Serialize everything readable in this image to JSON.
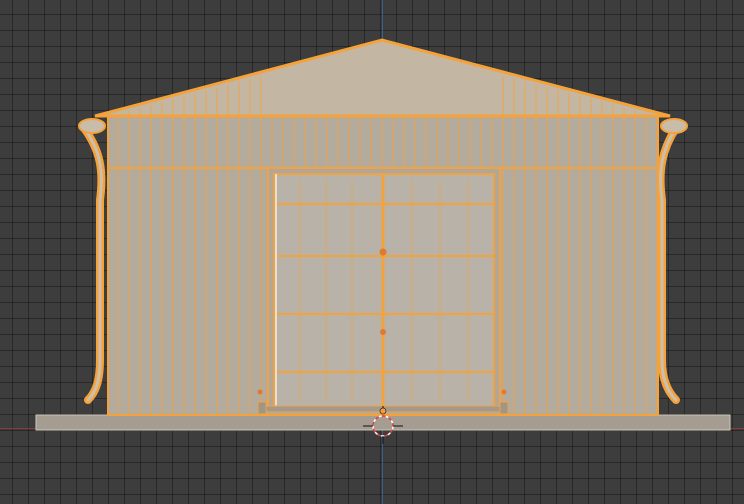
{
  "colors": {
    "background": "#3d3d3d",
    "selection_outline": "#f5a23a",
    "mesh_fill": "#b4ab9f",
    "roof_fill": "#c3b6a3",
    "foundation_fill": "#a69d92",
    "axis_x": "#8a3b3b",
    "axis_z": "#3b5f8f"
  },
  "viewport": {
    "object": "shed-mesh",
    "view": "front-orthographic",
    "selected": true
  },
  "icons": [
    "3d-cursor-icon",
    "object-origin-icon"
  ]
}
